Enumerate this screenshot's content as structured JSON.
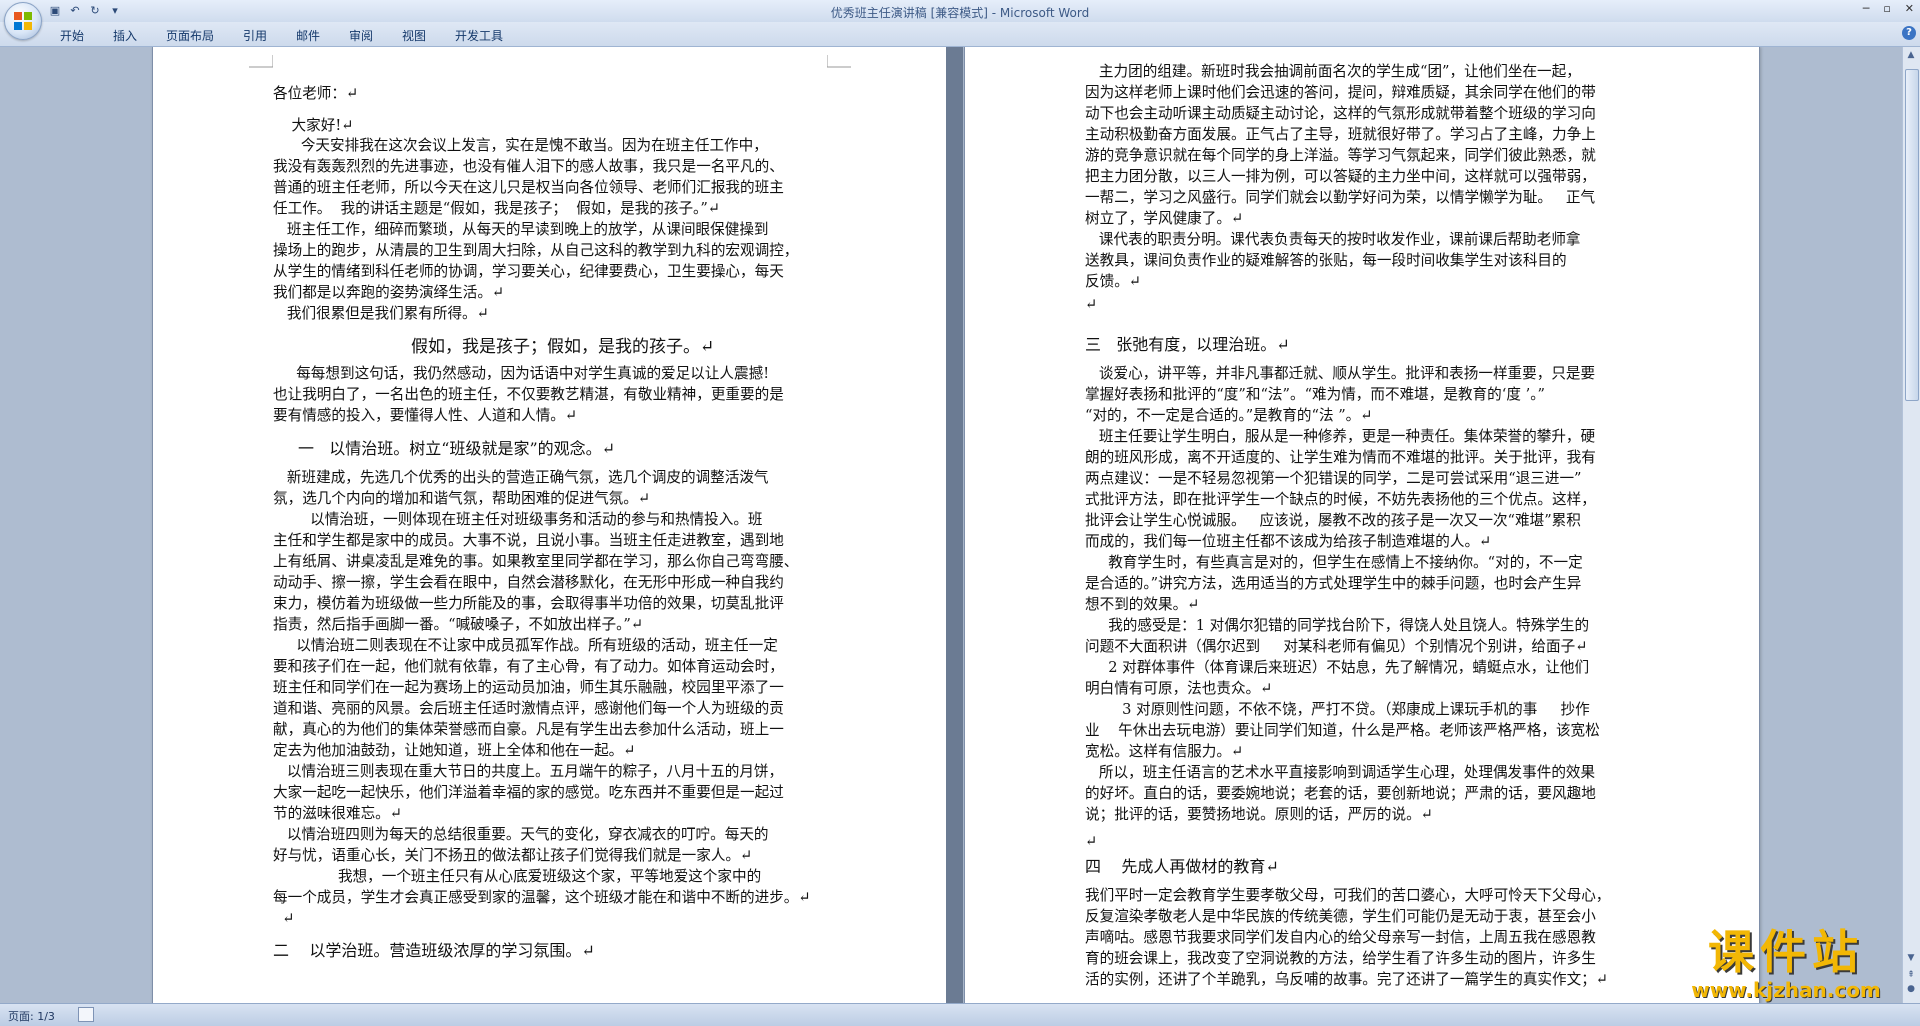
{
  "window": {
    "title_doc": "优秀班主任演讲稿 [兼容模式] - ",
    "title_app": "Microsoft Word"
  },
  "qat": {
    "save_icon": "save-icon",
    "undo_icon": "undo-icon",
    "redo_icon": "redo-icon",
    "customize_icon": "dropdown-icon"
  },
  "ribbon": {
    "tabs": [
      "开始",
      "插入",
      "页面布局",
      "引用",
      "邮件",
      "审阅",
      "视图",
      "开发工具"
    ]
  },
  "left_page": {
    "lines": [
      "各位老师：↵",
      "    大家好!↵",
      "      今天安排我在这次会议上发言，实在是愧不敢当。因为在班主任工作中，",
      "我没有轰轰烈烈的先进事迹，也没有催人泪下的感人故事，我只是一名平凡的、",
      "普通的班主任老师，所以今天在这儿只是权当向各位领导、老师们汇报我的班主",
      "任工作。  我的讲话主题是“假如，我是孩子；  假如，是我的孩子。”↵",
      "   班主任工作，细碎而繁琐，从每天的早读到晚上的放学，从课间眼保健操到",
      "操场上的跑步，从清晨的卫生到周大扫除，从自己这科的教学到九科的宏观调控，",
      "从学生的情绪到科任老师的协调，学习要关心，纪律要费心，卫生要操心，每天",
      "我们都是以奔跑的姿势演绎生活。↵",
      "   我们很累但是我们累有所得。↵"
    ],
    "title_center": "假如，我是孩子；假如，是我的孩子。↵",
    "lines2": [
      "     每每想到这句话，我仍然感动，因为话语中对学生真诚的爱足以让人震撼!",
      "也让我明白了，一名出色的班主任，不仅要教艺精湛，有敬业精神，更重要的是",
      "要有情感的投入，要懂得人性、人道和人情。↵"
    ],
    "heading1": "一   以情治班。树立“班级就是家”的观念。↵",
    "lines3": [
      "   新班建成，先选几个优秀的出头的营造正确气氛，选几个调皮的调整活泼气",
      "氛，选几个内向的增加和谐气氛，帮助困难的促进气氛。↵",
      "        以情治班，一则体现在班主任对班级事务和活动的参与和热情投入。班",
      "主任和学生都是家中的成员。大事不说，且说小事。当班主任走进教室，遇到地",
      "上有纸屑、讲桌凌乱是难免的事。如果教室里同学都在学习，那么你自己弯弯腰、",
      "动动手、擦一擦，学生会看在眼中，自然会潜移默化，在无形中形成一种自我约",
      "束力，模仿着为班级做一些力所能及的事，会取得事半功倍的效果，切莫乱批评",
      "指责，然后指手画脚一番。“喊破嗓子，不如放出样子。”↵",
      "     以情治班二则表现在不让家中成员孤军作战。所有班级的活动，班主任一定",
      "要和孩子们在一起，他们就有依靠，有了主心骨，有了动力。如体育运动会时，",
      "班主任和同学们在一起为赛场上的运动员加油，师生其乐融融，校园里平添了一",
      "道和谐、亮丽的风景。会后班主任适时激情点评，感谢他们每一个人为班级的贡",
      "献，真心的为他们的集体荣誉感而自豪。凡是有学生出去参加什么活动，班上一",
      "定去为他加油鼓劲，让她知道，班上全体和他在一起。↵",
      "   以情治班三则表现在重大节日的共度上。五月端午的粽子，八月十五的月饼，",
      "大家一起吃一起快乐，他们洋溢着幸福的家的感觉。吃东西并不重要但是一起过",
      "节的滋味很难忘。↵",
      "   以情治班四则为每天的总结很重要。天气的变化，穿衣减衣的叮咛。每天的",
      "好与忧，语重心长，关门不扬丑的做法都让孩子们觉得我们就是一家人。↵",
      "              我想，一个班主任只有从心底爱班级这个家，平等地爱这个家中的",
      "每一个成员，学生才会真正感受到家的温馨，这个班级才能在和谐中不断的进步。↵",
      "  ↵"
    ],
    "heading2": "二    以学治班。营造班级浓厚的学习氛围。↵"
  },
  "right_page": {
    "lines": [
      "   主力团的组建。新班时我会抽调前面名次的学生成“团”，让他们坐在一起，",
      "因为这样老师上课时他们会迅速的答问，提问，辩难质疑，其余同学在他们的带",
      "动下也会主动听课主动质疑主动讨论，这样的气氛形成就带着整个班级的学习向",
      "主动积极勤奋方面发展。正气占了主导，班就很好带了。学习占了主峰，力争上",
      "游的竞争意识就在每个同学的身上洋溢。等学习气氛起来，同学们彼此熟悉，就",
      "把主力团分散，以三人一排为例，可以答疑的主力坐中间，这样就可以强带弱，",
      "一帮二，学习之风盛行。同学们就会以勤学好问为荣，以情学懒学为耻。   正气",
      "树立了，学风健康了。↵",
      "   课代表的职责分明。课代表负责每天的按时收发作业，课前课后帮助老师拿",
      "送教具，课间负责作业的疑难解答的张贴，每一段时间收集学生对该科目的",
      "反馈。↵",
      "↵"
    ],
    "heading3": "三   张弛有度，以理治班。↵",
    "lines2": [
      "   谈爱心，讲平等，并非凡事都迁就、顺从学生。批评和表扬一样重要，只是要",
      "掌握好表扬和批评的“度”和“法”。“难为情，而不难堪，是教育的‘度 ’。”",
      "“对的，不一定是合适的。”是教育的“法 ”。↵",
      "   班主任要让学生明白，服从是一种修养，更是一种责任。集体荣誉的攀升，硬",
      "朗的班风形成，离不开适度的、让学生难为情而不难堪的批评。关于批评，我有",
      "两点建议：一是不轻易忽视第一个犯错误的同学，二是可尝试采用“退三进一”",
      "式批评方法，即在批评学生一个缺点的时候，不妨先表扬他的三个优点。这样，",
      "批评会让学生心悦诚服。   应该说，屡教不改的孩子是一次又一次“难堪”累积",
      "而成的，我们每一位班主任都不该成为给孩子制造难堪的人。↵",
      "     教育学生时，有些真言是对的，但学生在感情上不接纳你。“对的，不一定",
      "是合适的。”讲究方法，选用适当的方式处理学生中的棘手问题，也时会产生异",
      "想不到的效果。↵",
      "     我的感受是：1 对偶尔犯错的同学找台阶下，得饶人处且饶人。特殊学生的",
      "问题不大面积讲（偶尔迟到     对某科老师有偏见）个别情况个别讲，给面子↵",
      "     2 对群体事件（体育课后来班迟）不姑息，先了解情况，蜻蜓点水，让他们",
      "明白情有可原，法也责众。↵",
      "        3 对原则性问题，不依不饶，严打不贷。（郑康成上课玩手机的事     抄作",
      "业    午休出去玩电游）要让同学们知道，什么是严格。老师该严格严格，该宽松",
      "宽松。这样有信服力。↵",
      "   所以，班主任语言的艺术水平直接影响到调适学生心理，处理偶发事件的效果",
      "的好坏。直白的话，要委婉地说；老套的话，要创新地说；严肃的话，要风趣地",
      "说；批评的话，要赞扬地说。原则的话，严厉的说。↵",
      "",
      "↵"
    ],
    "heading4": "四    先成人再做材的教育↵",
    "lines3": [
      "我们平时一定会教育学生要孝敬父母，可我们的苦口婆心，大呼可怜天下父母心，",
      "反复渲染孝敬老人是中华民族的传统美德，学生们可能仍是无动于衷，甚至会小",
      "声嘀咕。感恩节我要求同学们发自内心的给父母亲写一封信，上周五我在感恩教",
      "育的班会课上，我改变了空洞说教的方法，给学生看了许多生动的图片，许多生",
      "活的实例，还讲了个羊跪乳，乌反哺的故事。完了还讲了一篇学生的真实作文；↵"
    ]
  },
  "status": {
    "page": "页面: 1/3"
  },
  "watermark": {
    "title": "课件站",
    "url": "www.kjzhan.com"
  }
}
